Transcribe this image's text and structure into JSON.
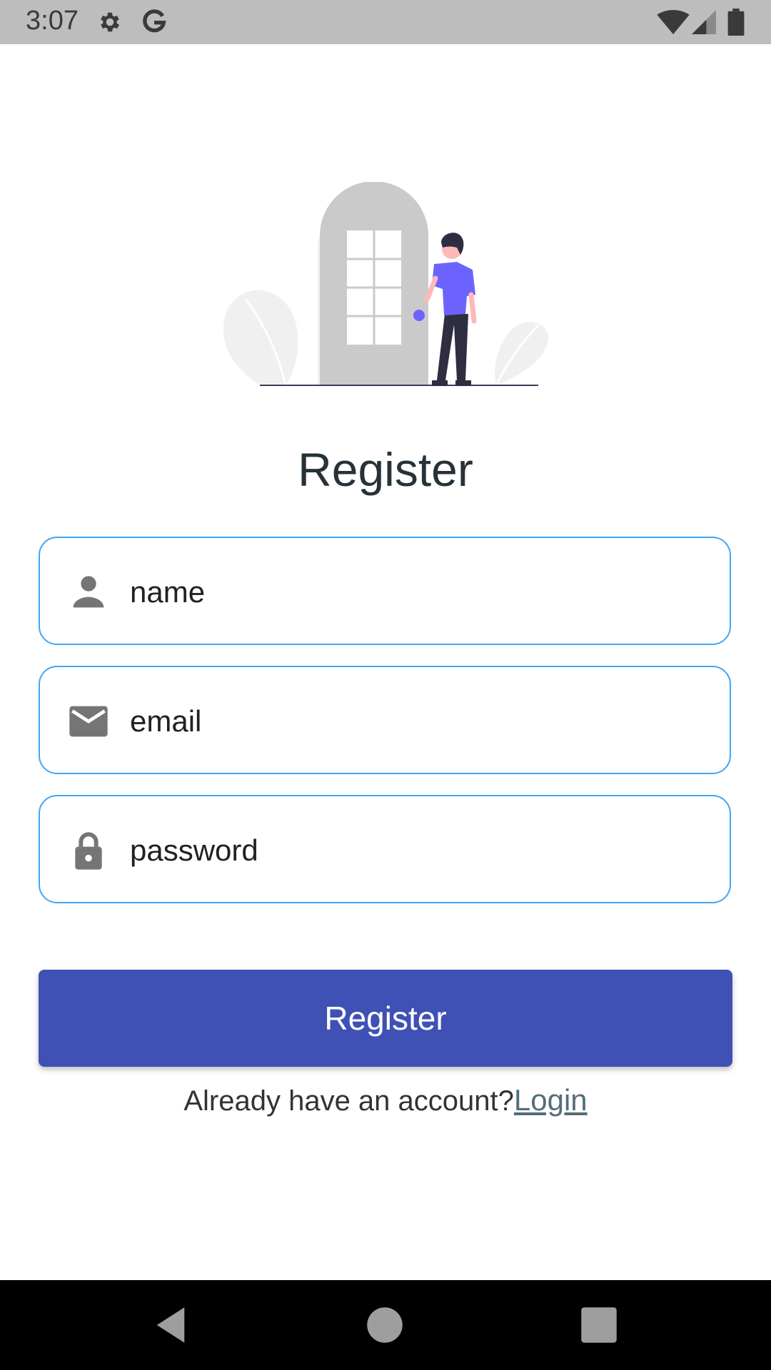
{
  "status_bar": {
    "time": "3:07",
    "icons": [
      "settings-icon",
      "google-icon",
      "wifi-icon",
      "cell-signal-icon",
      "battery-icon"
    ]
  },
  "register": {
    "title": "Register",
    "fields": {
      "name": {
        "placeholder": "name",
        "icon": "person-icon"
      },
      "email": {
        "placeholder": "email",
        "icon": "mail-icon"
      },
      "password": {
        "placeholder": "password",
        "icon": "lock-icon"
      }
    },
    "button_label": "Register",
    "login_prompt": "Already have an account?",
    "login_link": "Login"
  },
  "nav_bar": {
    "buttons": [
      "back-icon",
      "home-icon",
      "recents-icon"
    ]
  },
  "colors": {
    "accent": "#3f51b5",
    "field_border": "#42a5f5",
    "link": "#546e7a",
    "title": "#263238"
  }
}
